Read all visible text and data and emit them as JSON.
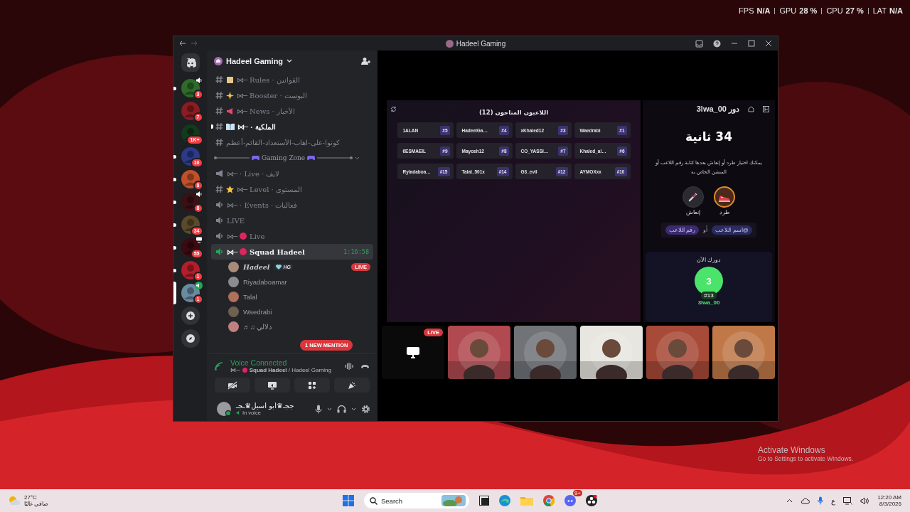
{
  "overlay": {
    "stats": [
      {
        "label": "FPS",
        "value": "N/A"
      },
      {
        "label": "GPU",
        "value": "28 %"
      },
      {
        "label": "CPU",
        "value": "27 %"
      },
      {
        "label": "LAT",
        "value": "N/A"
      }
    ]
  },
  "window": {
    "title": "Hadeel Gaming"
  },
  "servers": [
    {
      "badge": "3",
      "unread": true,
      "selected": false,
      "speaker": true,
      "screen": false
    },
    {
      "badge": "7",
      "unread": false,
      "selected": false,
      "speaker": false,
      "screen": false
    },
    {
      "badge": "1K+",
      "unread": false,
      "selected": false,
      "speaker": false,
      "screen": false
    },
    {
      "badge": "10",
      "unread": true,
      "selected": false,
      "speaker": false,
      "screen": false
    },
    {
      "badge": "8",
      "unread": true,
      "selected": false,
      "speaker": false,
      "screen": false
    },
    {
      "badge": "8",
      "unread": true,
      "selected": false,
      "speaker": true,
      "screen": false
    },
    {
      "badge": "34",
      "unread": true,
      "selected": false,
      "speaker": false,
      "screen": false
    },
    {
      "badge": "55",
      "unread": true,
      "selected": false,
      "speaker": false,
      "screen": true
    },
    {
      "badge": "1",
      "unread": true,
      "selected": false,
      "speaker": false,
      "screen": false
    },
    {
      "badge": "1",
      "unread": false,
      "selected": true,
      "speaker": true,
      "screen": false
    }
  ],
  "server_header": {
    "name": "Hadeel Gaming"
  },
  "channels": [
    {
      "kind": "text",
      "prefix": "⋈─",
      "name": "Rules · القوانين",
      "unread": false,
      "selected": false
    },
    {
      "kind": "text",
      "prefix": "⋈─",
      "name": "Booster · البوست",
      "unread": false,
      "selected": false
    },
    {
      "kind": "text",
      "prefix": "⋈─",
      "name": "News · الأخبار",
      "unread": false,
      "selected": false
    },
    {
      "kind": "text",
      "prefix": "⋈─",
      "name": "· الملكية",
      "unread": true,
      "selected": false
    },
    {
      "kind": "text",
      "name": "كونوا-على-اهاب-الأستعداد-القائم-أعظم",
      "unread": false,
      "selected": false
    },
    {
      "kind": "category",
      "name": "Gaming Zone"
    },
    {
      "kind": "stage",
      "prefix": "⋈─",
      "name": "· Live · لايف",
      "unread": false,
      "selected": false
    },
    {
      "kind": "text",
      "prefix": "⋈─",
      "name": "Level · المستوى",
      "unread": false,
      "selected": false
    },
    {
      "kind": "voice",
      "prefix": "⋈─",
      "name": "· Events · فعاليات",
      "unread": false,
      "selected": false
    },
    {
      "kind": "voice",
      "name": "LIVE",
      "unread": false,
      "selected": false
    },
    {
      "kind": "voice",
      "prefix": "⋈─",
      "name": "Live",
      "unread": false,
      "selected": false
    },
    {
      "kind": "voice",
      "prefix": "⋈─",
      "name": "Squad Hadeel",
      "unread": true,
      "selected": true,
      "timer": "1:16:58",
      "members": [
        {
          "name": "Hadeel",
          "tag": "HG",
          "live": true
        },
        {
          "name": "Riyadaboamar",
          "live": false
        },
        {
          "name": "Talal",
          "live": false
        },
        {
          "name": "Waedrabi",
          "live": false
        },
        {
          "name": "♬♫ دلالي",
          "live": false
        }
      ]
    }
  ],
  "live_label": "LIVE",
  "mention": "1 NEW MENTION",
  "voice": {
    "status": "Voice Connected",
    "prefix": "⋈─",
    "location": "**Squad Hadeel** / Hadeel Gaming"
  },
  "user": {
    "name": "ججـ♛ابو اسيل♛ـجـ",
    "status": "In voice"
  },
  "players": {
    "title": "اللاعبون المتاحون (12)",
    "list": [
      {
        "name": "1ALAN",
        "number": "#5"
      },
      {
        "name": "HadeelGa…",
        "number": "#4"
      },
      {
        "name": "xKhaled12",
        "number": "#3"
      },
      {
        "name": "Waedrabi",
        "number": "#1"
      },
      {
        "name": "6ESMAEIL",
        "number": "#9"
      },
      {
        "name": "Mayosh12",
        "number": "#8"
      },
      {
        "name": "CO_YASSI…",
        "number": "#7"
      },
      {
        "name": "Khaled_al…",
        "number": "#6"
      },
      {
        "name": "Ryiadaboa…",
        "number": "#15"
      },
      {
        "name": "Talal_501x",
        "number": "#14"
      },
      {
        "name": "G3_evil",
        "number": "#12"
      },
      {
        "name": "AYMOXxx",
        "number": "#10"
      }
    ]
  },
  "turn_panel": {
    "header": "دور 3lwa_00",
    "timer": "34 ثانية",
    "hint": "يمكنك اختيار طرد أو إنعاش بعدها كتابة رقم اللاعب أو المنشن الخاص به",
    "actions": [
      {
        "kind": "kick",
        "label": "طرد",
        "selected": true
      },
      {
        "kind": "revive",
        "label": "إنعاش",
        "selected": false
      }
    ],
    "chips": [
      "@اسم اللاعب",
      "رقم اللاعب"
    ],
    "or": "أو",
    "current": {
      "label": "دورك الآن",
      "number": "3",
      "tag": "#13",
      "name": "3lwa_00"
    }
  },
  "tiles": [
    {
      "kind": "stream",
      "live": "LIVE"
    },
    {
      "kind": "picture"
    },
    {
      "kind": "picture"
    },
    {
      "kind": "picture"
    },
    {
      "kind": "picture"
    },
    {
      "kind": "picture"
    }
  ],
  "activation": {
    "title": "Activate Windows",
    "subtitle": "Go to Settings to activate Windows."
  },
  "taskbar": {
    "weather": {
      "temp": "27°C",
      "desc": "صافي غالبًا"
    },
    "search": {
      "placeholder": "Search"
    },
    "apps": [
      {
        "kind": "taskview"
      },
      {
        "kind": "edge"
      },
      {
        "kind": "files"
      },
      {
        "kind": "chrome"
      },
      {
        "kind": "discord",
        "badge": "9+"
      },
      {
        "kind": "obs"
      }
    ],
    "ime": "ع",
    "time": "12:20 AM",
    "date": "8/3/2026"
  }
}
